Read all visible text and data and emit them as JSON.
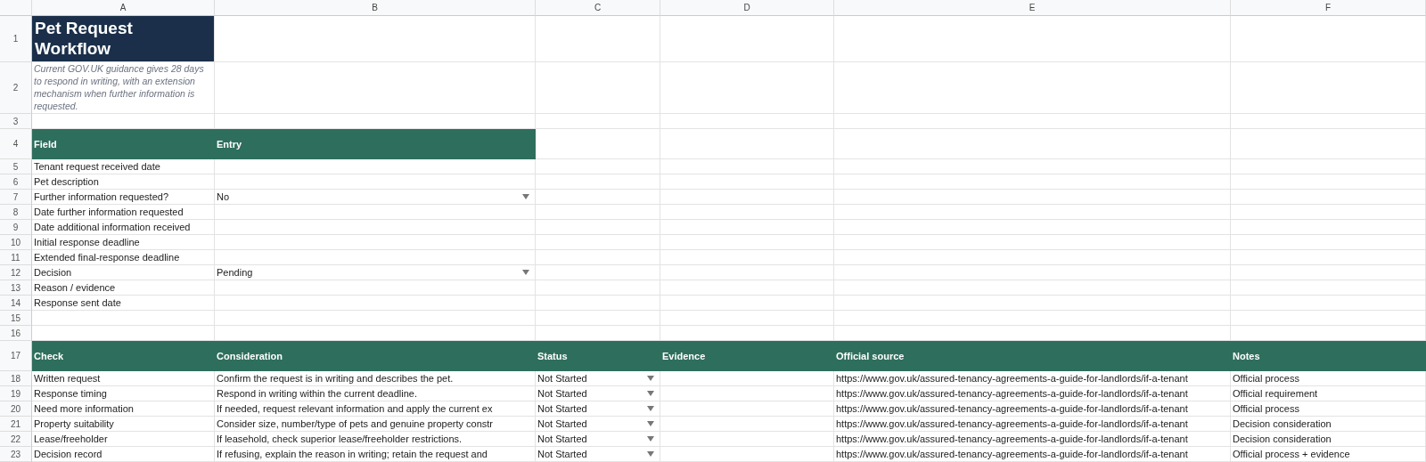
{
  "column_headers": [
    "A",
    "B",
    "C",
    "D",
    "E",
    "F"
  ],
  "row_numbers": [
    "1",
    "2",
    "3",
    "4",
    "5",
    "6",
    "7",
    "8",
    "9",
    "10",
    "11",
    "12",
    "13",
    "14",
    "15",
    "16",
    "17",
    "18",
    "19",
    "20",
    "21",
    "22",
    "23"
  ],
  "title": "Pet Request Workflow",
  "note": "Current GOV.UK guidance gives 28 days to respond in writing, with an extension mechanism when further information is requested.",
  "form": {
    "columns": [
      "Field",
      "Entry"
    ],
    "rows": [
      {
        "field": "Tenant request received date"
      },
      {
        "field": "Pet description"
      },
      {
        "field": "Further information requested?",
        "entry": "No",
        "kind": "dropdown"
      },
      {
        "field": "Date further information requested"
      },
      {
        "field": "Date additional information received"
      },
      {
        "field": "Initial response deadline"
      },
      {
        "field": "Extended final-response deadline"
      },
      {
        "field": "Decision",
        "entry": "Pending",
        "kind": "dropdown"
      },
      {
        "field": "Reason / evidence"
      },
      {
        "field": "Response sent date"
      }
    ]
  },
  "checks": {
    "columns": [
      "Check",
      "Consideration",
      "Status",
      "Evidence",
      "Official source",
      "Notes"
    ],
    "rows": [
      {
        "check": "Written request",
        "consideration": "Confirm the request is in writing and describes the pet.",
        "status": "Not Started",
        "source": "https://www.gov.uk/assured-tenancy-agreements-a-guide-for-landlords/if-a-tenant",
        "notes": "Official process"
      },
      {
        "check": "Response timing",
        "consideration": "Respond in writing within the current deadline.",
        "status": "Not Started",
        "source": "https://www.gov.uk/assured-tenancy-agreements-a-guide-for-landlords/if-a-tenant",
        "notes": "Official requirement"
      },
      {
        "check": "Need more information",
        "consideration": "If needed, request relevant information and apply the current ex",
        "status": "Not Started",
        "source": "https://www.gov.uk/assured-tenancy-agreements-a-guide-for-landlords/if-a-tenant",
        "notes": "Official process"
      },
      {
        "check": "Property suitability",
        "consideration": "Consider size, number/type of pets and genuine property constr",
        "status": "Not Started",
        "source": "https://www.gov.uk/assured-tenancy-agreements-a-guide-for-landlords/if-a-tenant",
        "notes": "Decision consideration"
      },
      {
        "check": "Lease/freeholder",
        "consideration": "If leasehold, check superior lease/freeholder restrictions.",
        "status": "Not Started",
        "source": "https://www.gov.uk/assured-tenancy-agreements-a-guide-for-landlords/if-a-tenant",
        "notes": "Decision consideration"
      },
      {
        "check": "Decision record",
        "consideration": "If refusing, explain the reason in writing; retain the request and",
        "status": "Not Started",
        "source": "https://www.gov.uk/assured-tenancy-agreements-a-guide-for-landlords/if-a-tenant",
        "notes": "Official process + evidence"
      }
    ]
  }
}
